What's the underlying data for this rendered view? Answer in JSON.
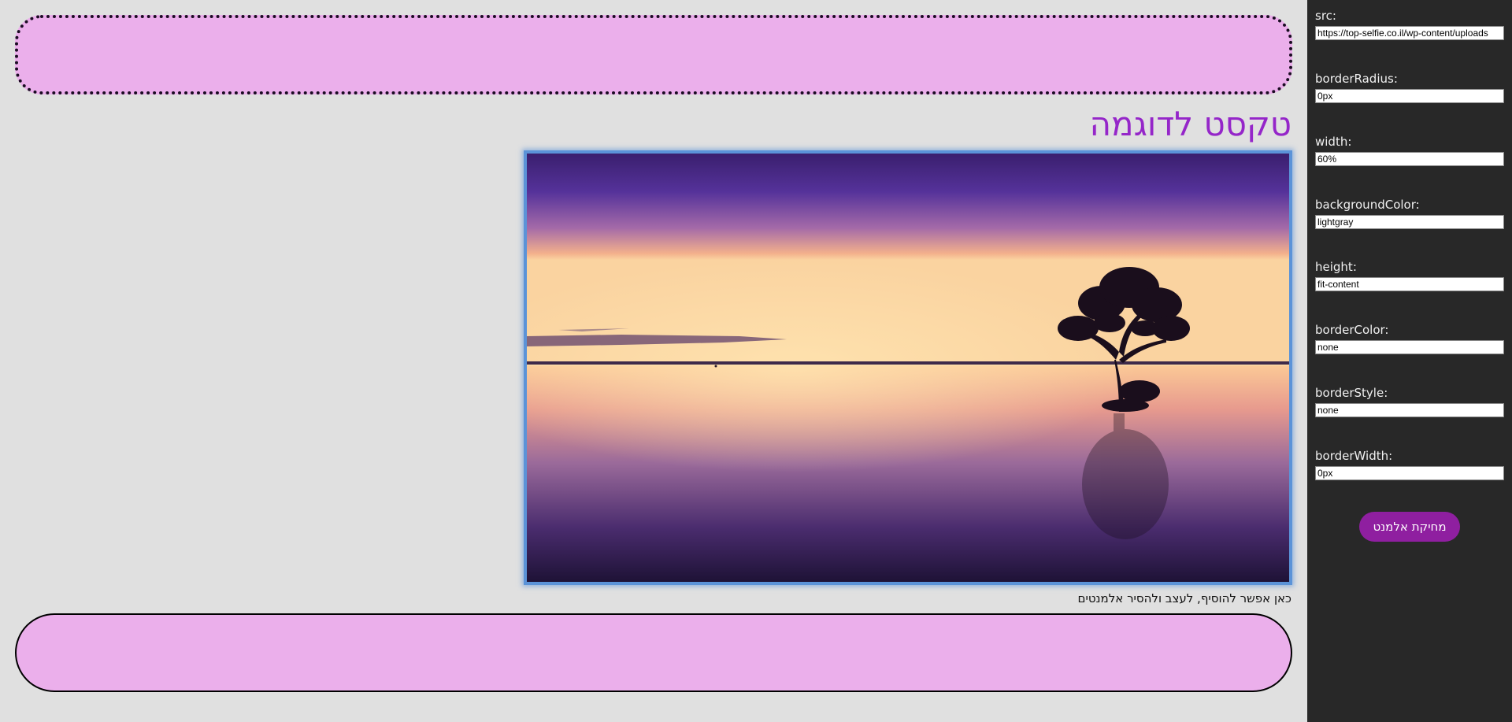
{
  "canvas": {
    "heading": "טקסט לדוגמה",
    "caption": "כאן אפשר להוסיף, לעצב ולהסיר אלמנטים"
  },
  "panel": {
    "fields": [
      {
        "label": "src:",
        "value": "https://top-selfie.co.il/wp-content/uploads"
      },
      {
        "label": "borderRadius:",
        "value": "0px"
      },
      {
        "label": "width:",
        "value": "60%"
      },
      {
        "label": "backgroundColor:",
        "value": "lightgray"
      },
      {
        "label": "height:",
        "value": "fit-content"
      },
      {
        "label": "borderColor:",
        "value": "none"
      },
      {
        "label": "borderStyle:",
        "value": "none"
      },
      {
        "label": "borderWidth:",
        "value": "0px"
      }
    ],
    "delete_label": "מחיקת אלמנט"
  },
  "colors": {
    "box_fill": "#ebafeb",
    "heading": "#9526c9",
    "panel_bg": "#282828",
    "delete_button": "#8f1fa0",
    "image_border": "#5b93d8"
  }
}
